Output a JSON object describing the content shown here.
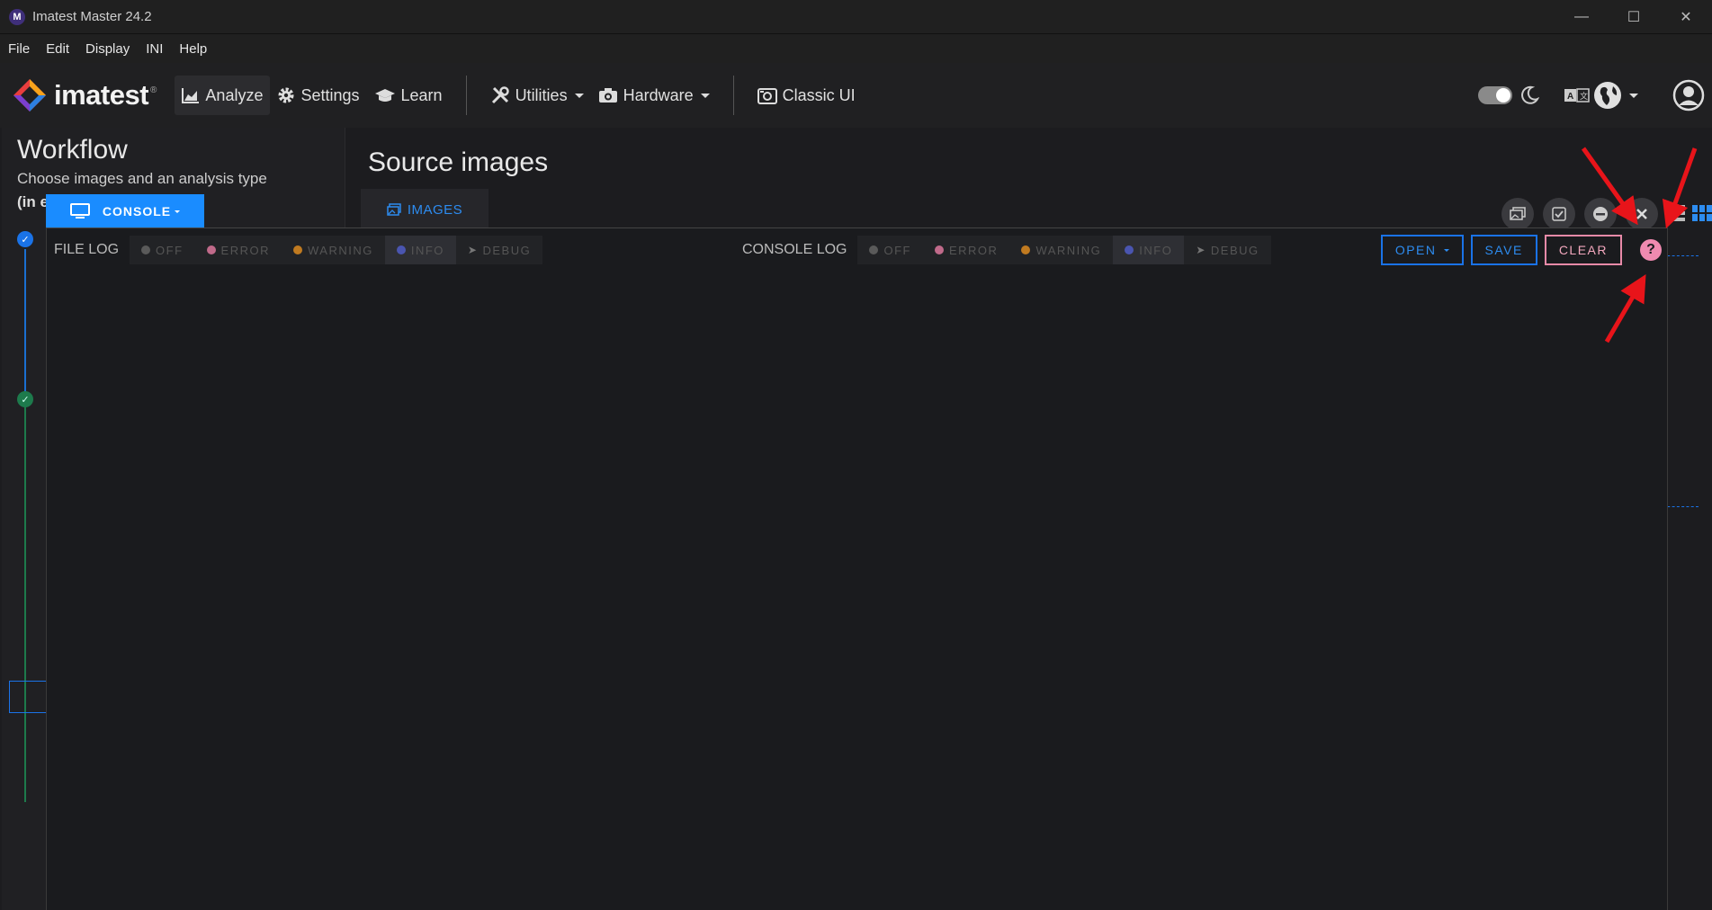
{
  "window": {
    "title": "Imatest Master 24.2",
    "icon_letter": "M",
    "controls": [
      "minimize-icon",
      "maximize-icon",
      "close-icon"
    ]
  },
  "menu": [
    "File",
    "Edit",
    "Display",
    "INI",
    "Help"
  ],
  "nav": {
    "logo_text": "imatest",
    "logo_reg": "®",
    "items": [
      {
        "label": "Analyze",
        "icon": "chart-area-icon",
        "active": true
      },
      {
        "label": "Settings",
        "icon": "gear-icon"
      },
      {
        "label": "Learn",
        "icon": "graduation-cap-icon"
      },
      {
        "label": "Utilities",
        "icon": "tools-icon",
        "dropdown": true
      },
      {
        "label": "Hardware",
        "icon": "camera-icon",
        "dropdown": true
      },
      {
        "label": "Classic UI",
        "icon": "classic-camera-icon"
      }
    ],
    "theme_toggle": "dark",
    "language_icon": "translate-icon",
    "globe_icon": "globe-icon",
    "user_icon": "user-circle-icon"
  },
  "workflow": {
    "title": "Workflow",
    "subtitle": "Choose images and an analysis type",
    "subtitle2": "(in e"
  },
  "source": {
    "title": "Source images",
    "tab_label": "IMAGES",
    "tools": [
      "image-icon",
      "check-square-icon",
      "minus-icon",
      "x-icon"
    ],
    "view_icons": [
      "list-view-icon",
      "grid-view-icon"
    ]
  },
  "console": {
    "tab_label": "CONSOLE",
    "file_log_label": "FILE LOG",
    "console_log_label": "CONSOLE LOG",
    "levels": [
      {
        "label": "OFF",
        "color": "#5a5a5a"
      },
      {
        "label": "ERROR",
        "color": "#c06a8a"
      },
      {
        "label": "WARNING",
        "color": "#c07a20"
      },
      {
        "label": "INFO",
        "color": "#4a55b0"
      },
      {
        "label": "DEBUG",
        "color": "#666666"
      }
    ],
    "active_level": "INFO",
    "buttons": {
      "open": "OPEN",
      "save": "SAVE",
      "clear": "CLEAR"
    },
    "help": "?"
  },
  "colors": {
    "accent": "#1a8cff",
    "annotation": "#e8141a"
  }
}
